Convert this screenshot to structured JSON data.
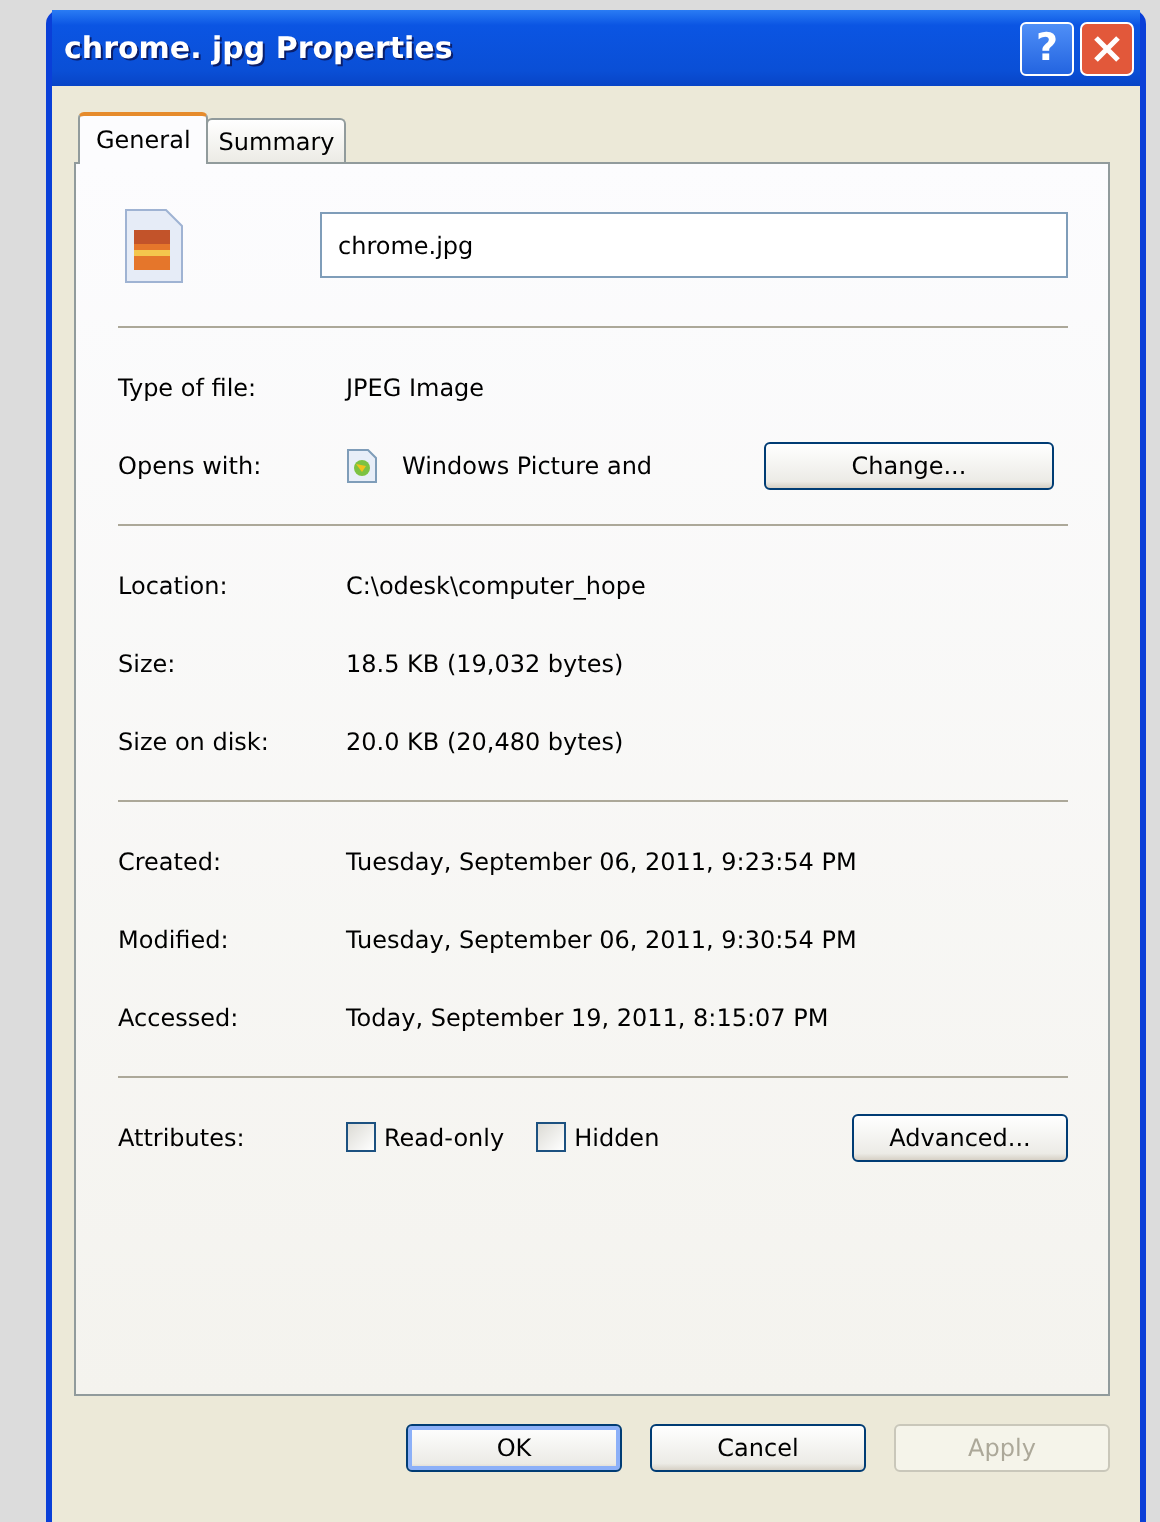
{
  "window": {
    "title": "chrome. jpg Properties",
    "help_button": "?"
  },
  "tabs": [
    {
      "label": "General",
      "selected": true
    },
    {
      "label": "Summary",
      "selected": false
    }
  ],
  "file": {
    "name": "chrome.jpg"
  },
  "sections": [
    {
      "rows": [
        {
          "kind": "text",
          "label": "Type of file:",
          "value": "JPEG Image"
        },
        {
          "kind": "app",
          "label": "Opens with:",
          "value": "Windows Picture and",
          "button": "Change..."
        }
      ]
    },
    {
      "rows": [
        {
          "kind": "text",
          "label": "Location:",
          "value": "C:\\odesk\\computer_hope"
        },
        {
          "kind": "text",
          "label": "Size:",
          "value": "18.5 KB (19,032 bytes)"
        },
        {
          "kind": "text",
          "label": "Size on disk:",
          "value": "20.0 KB (20,480 bytes)"
        }
      ]
    },
    {
      "rows": [
        {
          "kind": "text",
          "label": "Created:",
          "value": "Tuesday, September 06, 2011, 9:23:54 PM"
        },
        {
          "kind": "text",
          "label": "Modified:",
          "value": "Tuesday, September 06, 2011, 9:30:54 PM"
        },
        {
          "kind": "text",
          "label": "Accessed:",
          "value": "Today, September 19, 2011, 8:15:07 PM"
        }
      ]
    },
    {
      "rows": [
        {
          "kind": "attributes",
          "label": "Attributes:",
          "checkboxes": [
            {
              "label": "Read-only",
              "checked": false
            },
            {
              "label": "Hidden",
              "checked": false
            }
          ],
          "button": "Advanced..."
        }
      ]
    }
  ],
  "buttons": [
    {
      "label": "OK",
      "default": true,
      "disabled": false
    },
    {
      "label": "Cancel",
      "default": false,
      "disabled": false
    },
    {
      "label": "Apply",
      "default": false,
      "disabled": true
    }
  ]
}
